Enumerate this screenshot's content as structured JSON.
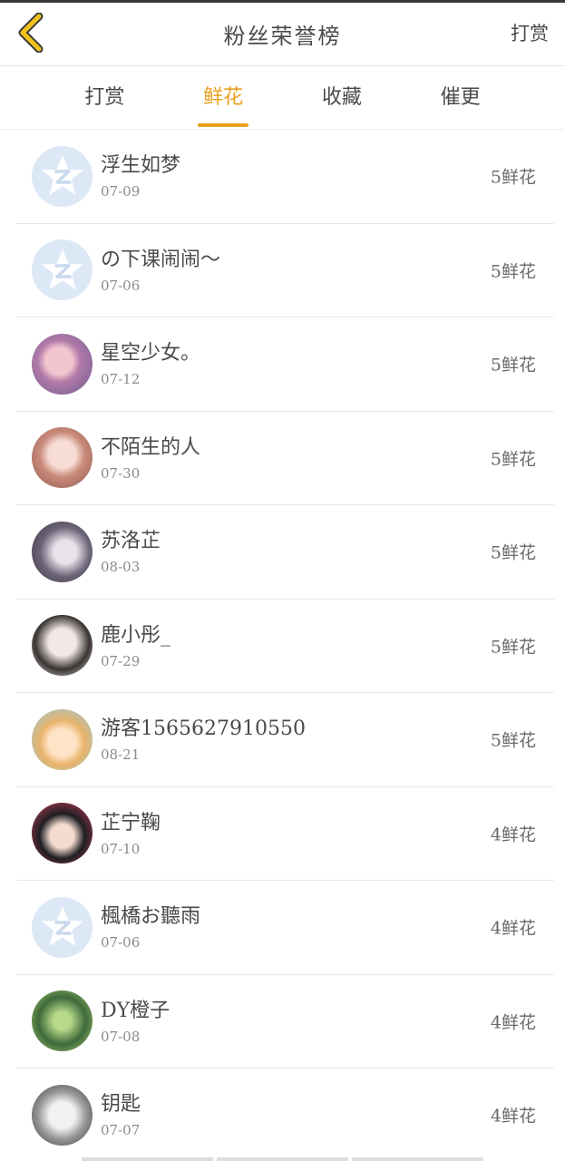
{
  "header": {
    "title": "粉丝荣誉榜",
    "right_label": "打赏",
    "back_icon": "chevron-left-icon",
    "accent": "#e9a020"
  },
  "tabs": [
    {
      "label": "打赏",
      "active": false
    },
    {
      "label": "鲜花",
      "active": true
    },
    {
      "label": "收藏",
      "active": false
    },
    {
      "label": "催更",
      "active": false
    }
  ],
  "rows": [
    {
      "name": "浮生如梦",
      "date": "07-09",
      "amount": "5鲜花",
      "avatar": "default-qq"
    },
    {
      "name": "の下课闹闹〜",
      "date": "07-06",
      "amount": "5鲜花",
      "avatar": "default-qq"
    },
    {
      "name": "星空少女。",
      "date": "07-12",
      "amount": "5鲜花",
      "avatar": "photo-purple"
    },
    {
      "name": "不陌生的人",
      "date": "07-30",
      "amount": "5鲜花",
      "avatar": "photo-pink"
    },
    {
      "name": "苏洛芷",
      "date": "08-03",
      "amount": "5鲜花",
      "avatar": "photo-dark"
    },
    {
      "name": "鹿小彤_",
      "date": "07-29",
      "amount": "5鲜花",
      "avatar": "photo-light"
    },
    {
      "name": "游客1565627910550",
      "date": "08-21",
      "amount": "5鲜花",
      "avatar": "cartoon-girl"
    },
    {
      "name": "芷宁鞠",
      "date": "07-10",
      "amount": "4鲜花",
      "avatar": "photo-girl"
    },
    {
      "name": "楓橋お聽雨",
      "date": "07-06",
      "amount": "4鲜花",
      "avatar": "default-qq"
    },
    {
      "name": "DY橙子",
      "date": "07-08",
      "amount": "4鲜花",
      "avatar": "photo-green"
    },
    {
      "name": "钥匙",
      "date": "07-07",
      "amount": "4鲜花",
      "avatar": "sketch-dark"
    }
  ]
}
